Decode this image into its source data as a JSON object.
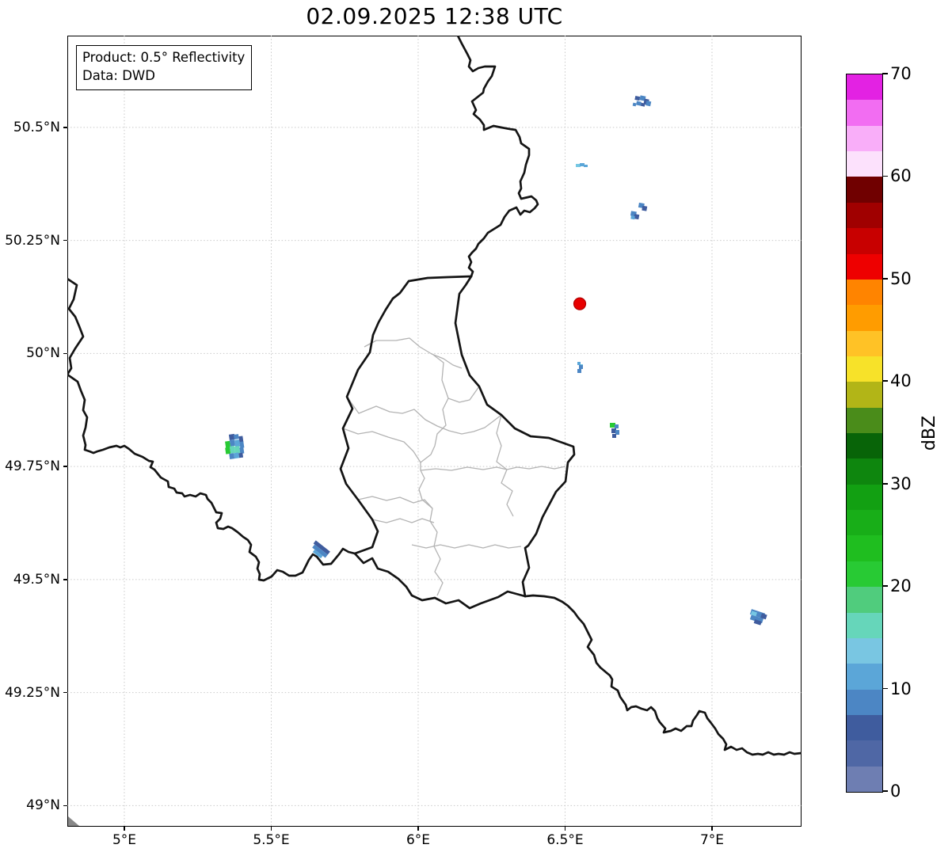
{
  "title": "02.09.2025 12:38 UTC",
  "info_box": {
    "product_line": "Product: 0.5° Reflectivity",
    "data_line": "Data: DWD"
  },
  "chart_data": {
    "type": "map",
    "subject": "Weather radar reflectivity over the Luxembourg / Belgium / Germany / France border region",
    "extent": {
      "lon_min": 4.81,
      "lon_max": 7.31,
      "lat_min": 48.95,
      "lat_max": 50.7
    },
    "grid": true,
    "x_ticks": [
      {
        "value": 5.0,
        "label": "5°E"
      },
      {
        "value": 5.5,
        "label": "5.5°E"
      },
      {
        "value": 6.0,
        "label": "6°E"
      },
      {
        "value": 6.5,
        "label": "6.5°E"
      },
      {
        "value": 7.0,
        "label": "7°E"
      }
    ],
    "y_ticks": [
      {
        "value": 50.5,
        "label": "50.5°N"
      },
      {
        "value": 50.25,
        "label": "50.25°N"
      },
      {
        "value": 50.0,
        "label": "50°N"
      },
      {
        "value": 49.75,
        "label": "49.75°N"
      },
      {
        "value": 49.5,
        "label": "49.5°N"
      },
      {
        "value": 49.25,
        "label": "49.25°N"
      },
      {
        "value": 49.0,
        "label": "49°N"
      }
    ],
    "colorbar": {
      "label": "dBZ",
      "min": 0,
      "max": 70,
      "tick_values": [
        0,
        10,
        20,
        30,
        40,
        50,
        60,
        70
      ],
      "band_step_dbz": 2.5,
      "band_colors_bottom_to_top": [
        "#6e7eb2",
        "#4f67a5",
        "#3f5c9e",
        "#4c86c4",
        "#5ba6d8",
        "#79c6e2",
        "#66d6ba",
        "#50cc7d",
        "#28ca34",
        "#1fbe1f",
        "#18ae18",
        "#12a012",
        "#0e860e",
        "#086408",
        "#4a8c1a",
        "#b2b517",
        "#f7e229",
        "#ffc226",
        "#ff9c00",
        "#ff8400",
        "#ee0000",
        "#c80000",
        "#a00000",
        "#700000",
        "#fce1fc",
        "#f9aef9",
        "#f26df2",
        "#e322e3"
      ]
    },
    "radar_site_marker": {
      "lon": 6.55,
      "lat": 50.11,
      "color": "#e80000",
      "edge_color": "#b00000",
      "radius_px": 7.5
    },
    "echoes": [
      {
        "name": "echo-north-northeast",
        "lon": 6.76,
        "lat": 50.56,
        "max_dbz": 10,
        "rotation_deg": 12,
        "cells": [
          [
            801,
            123,
            6,
            5,
            "#3f5c9e"
          ],
          [
            807,
            121,
            7,
            6,
            "#4c86c4"
          ],
          [
            813,
            124,
            6,
            7,
            "#3f5c9e"
          ],
          [
            804,
            129,
            6,
            5,
            "#4c86c4"
          ],
          [
            810,
            130,
            5,
            4,
            "#3f5c9e"
          ],
          [
            800,
            132,
            4,
            4,
            "#4c86c4"
          ],
          [
            816,
            126,
            6,
            6,
            "#4c86c4"
          ]
        ]
      },
      {
        "name": "echo-northeast-dash",
        "lon": 6.55,
        "lat": 50.42,
        "max_dbz": 13,
        "rotation_deg": 0,
        "cells": [
          [
            727,
            207,
            6,
            4,
            "#76c7e3"
          ],
          [
            732,
            206,
            6,
            4,
            "#5ba6d8"
          ],
          [
            737,
            208,
            5,
            3,
            "#5ba6d8"
          ]
        ]
      },
      {
        "name": "echo-east",
        "lon": 6.75,
        "lat": 50.32,
        "max_dbz": 10,
        "rotation_deg": 10,
        "cells": [
          [
            805,
            256,
            7,
            6,
            "#4c86c4"
          ],
          [
            810,
            259,
            6,
            6,
            "#3f5c9e"
          ],
          [
            797,
            268,
            7,
            6,
            "#4c86c4"
          ],
          [
            802,
            271,
            6,
            6,
            "#3f5c9e"
          ],
          [
            798,
            274,
            5,
            4,
            "#5ba6d8"
          ]
        ]
      },
      {
        "name": "echo-center-speck",
        "lon": 6.55,
        "lat": 49.97,
        "max_dbz": 13,
        "rotation_deg": 0,
        "cells": [
          [
            729,
            457,
            4,
            4,
            "#5ba6d8"
          ],
          [
            733,
            460,
            3,
            3,
            "#76c7e3"
          ],
          [
            731,
            461,
            5,
            5,
            "#4c86c4"
          ],
          [
            729,
            466,
            5,
            5,
            "#4c86c4"
          ]
        ]
      },
      {
        "name": "echo-east-green",
        "lon": 6.67,
        "lat": 49.83,
        "max_dbz": 22,
        "rotation_deg": 0,
        "cells": [
          [
            770,
            534,
            7,
            6,
            "#28ca34"
          ],
          [
            776,
            536,
            5,
            5,
            "#4c86c4"
          ],
          [
            772,
            541,
            6,
            6,
            "#3f5c9e"
          ],
          [
            777,
            543,
            5,
            6,
            "#4c86c4"
          ],
          [
            773,
            548,
            5,
            5,
            "#3f5c9e"
          ]
        ]
      },
      {
        "name": "echo-west-cluster",
        "lon": 5.37,
        "lat": 49.79,
        "max_dbz": 22,
        "rotation_deg": -8,
        "cells": [
          [
            291,
            548,
            7,
            7,
            "#3f5c9e"
          ],
          [
            297,
            549,
            6,
            6,
            "#4c86c4"
          ],
          [
            303,
            552,
            5,
            8,
            "#3f5c9e"
          ],
          [
            285,
            556,
            6,
            9,
            "#28ca34"
          ],
          [
            291,
            555,
            6,
            8,
            "#4c86c4"
          ],
          [
            297,
            556,
            6,
            9,
            "#5ba6d8"
          ],
          [
            303,
            559,
            5,
            8,
            "#4c86c4"
          ],
          [
            284,
            564,
            6,
            8,
            "#28ca34"
          ],
          [
            290,
            563,
            6,
            9,
            "#66d6ba"
          ],
          [
            296,
            564,
            6,
            9,
            "#66d6ba"
          ],
          [
            302,
            566,
            5,
            8,
            "#4c86c4"
          ],
          [
            288,
            572,
            6,
            7,
            "#4c86c4"
          ],
          [
            294,
            572,
            6,
            7,
            "#5ba6d8"
          ],
          [
            300,
            573,
            5,
            6,
            "#3f5c9e"
          ]
        ]
      },
      {
        "name": "echo-southwest-streak",
        "lon": 5.67,
        "lat": 49.56,
        "max_dbz": 12,
        "rotation_deg": 38,
        "cells": [
          [
            392,
            688,
            23,
            5,
            "#3f5c9e"
          ],
          [
            394,
            693,
            21,
            5,
            "#4c86c4"
          ],
          [
            398,
            698,
            13,
            4,
            "#5ba6d8"
          ]
        ]
      },
      {
        "name": "echo-southeast-patch",
        "lon": 7.15,
        "lat": 49.42,
        "max_dbz": 14,
        "rotation_deg": 18,
        "cells": [
          [
            946,
            772,
            18,
            7,
            "#4c86c4"
          ],
          [
            948,
            779,
            16,
            6,
            "#4c86c4"
          ],
          [
            947,
            774,
            7,
            5,
            "#76c7e3"
          ],
          [
            960,
            773,
            7,
            6,
            "#3f5c9e"
          ],
          [
            954,
            783,
            9,
            5,
            "#3f5c9e"
          ]
        ]
      }
    ]
  }
}
